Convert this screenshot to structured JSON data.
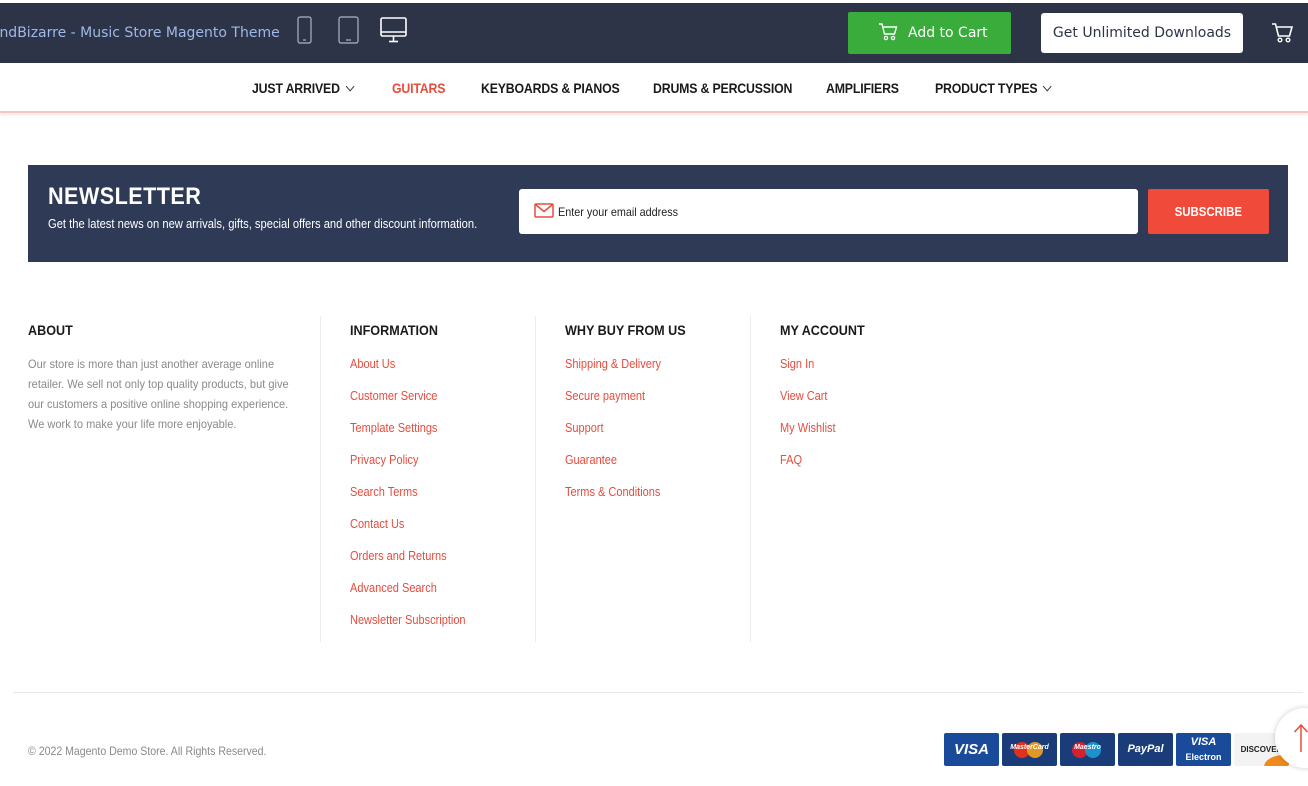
{
  "topbar": {
    "title": "oundBizarre - Music Store Magento Theme",
    "add_to_cart": "Add to Cart",
    "unlimited": "Get Unlimited Downloads"
  },
  "nav": {
    "items": [
      {
        "label": "JUST ARRIVED",
        "dropdown": true
      },
      {
        "label": "GUITARS",
        "active": true
      },
      {
        "label": "KEYBOARDS & PIANOS"
      },
      {
        "label": "DRUMS & PERCUSSION"
      },
      {
        "label": "AMPLIFIERS"
      },
      {
        "label": "PRODUCT TYPES",
        "dropdown": true
      }
    ]
  },
  "newsletter": {
    "title": "NEWSLETTER",
    "subtitle": "Get the latest news on new arrivals, gifts, special offers and other discount information.",
    "placeholder": "Enter your email address",
    "button": "SUBSCRIBE"
  },
  "footer": {
    "about": {
      "heading": "ABOUT",
      "text": "Our store is more than just another average online retailer. We sell not only top quality products, but give our customers a positive online shopping experience. We work to make your life more enjoyable."
    },
    "information": {
      "heading": "INFORMATION",
      "links": [
        "About Us",
        "Customer Service",
        "Template Settings",
        "Privacy Policy",
        "Search Terms",
        "Contact Us",
        "Orders and Returns",
        "Advanced Search",
        "Newsletter Subscription"
      ]
    },
    "why": {
      "heading": "WHY BUY FROM US",
      "links": [
        "Shipping & Delivery",
        "Secure payment",
        "Support",
        "Guarantee",
        "Terms & Conditions"
      ]
    },
    "account": {
      "heading": "MY ACCOUNT",
      "links": [
        "Sign In",
        "View Cart",
        "My Wishlist",
        "FAQ"
      ]
    },
    "copyright": "© 2022 Magento Demo Store. All Rights Reserved.",
    "payments": {
      "visa": "VISA",
      "mastercard": "MasterCard",
      "maestro": "Maestro",
      "paypal": "PayPal",
      "visa_electron_1": "VISA",
      "visa_electron_2": "Electron",
      "discover": "DISCOVER"
    }
  },
  "colors": {
    "topbar": "#2e3447",
    "accent": "#e94b3c",
    "newsletter_bg": "#2e3a56",
    "cart_green": "#3aac3c"
  }
}
